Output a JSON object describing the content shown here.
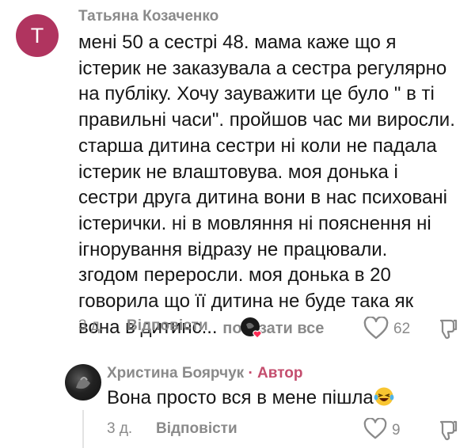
{
  "comment": {
    "avatar_letter": "T",
    "author": "Татьяна Козаченко",
    "lines": [
      "мені 50 а сестрі 48. мама каже що я",
      "істерик не заказувала а сестра регулярно",
      "на публіку. Хочу зауважити це було \" в ті",
      "правильні часи\". пройшов час ми виросли.",
      "старша дитина сестри ні коли не падала",
      "істерик не влаштовува. моя донька і",
      "сестри друга дитина вони в нас психовані",
      "істерички. ні в мовляння ні пояснення ні",
      "ігнорування відразу не працювали.",
      "згодом переросли. моя донька в 20",
      "говорила що її дитина не буде така як",
      "вона в дитинс..."
    ],
    "show_all": "показати все",
    "time": "3 д.",
    "reply_label": "Відповісти",
    "likes": "62"
  },
  "reply": {
    "author": "Христина Боярчук",
    "badge": "· Автор",
    "text": "Вона просто вся в мене пішла",
    "time": "3 д.",
    "reply_label": "Відповісти",
    "likes": "9"
  },
  "colors": {
    "avatar": "#b0345f",
    "badge": "#c44e6e",
    "muted": "#8a8a8a"
  }
}
